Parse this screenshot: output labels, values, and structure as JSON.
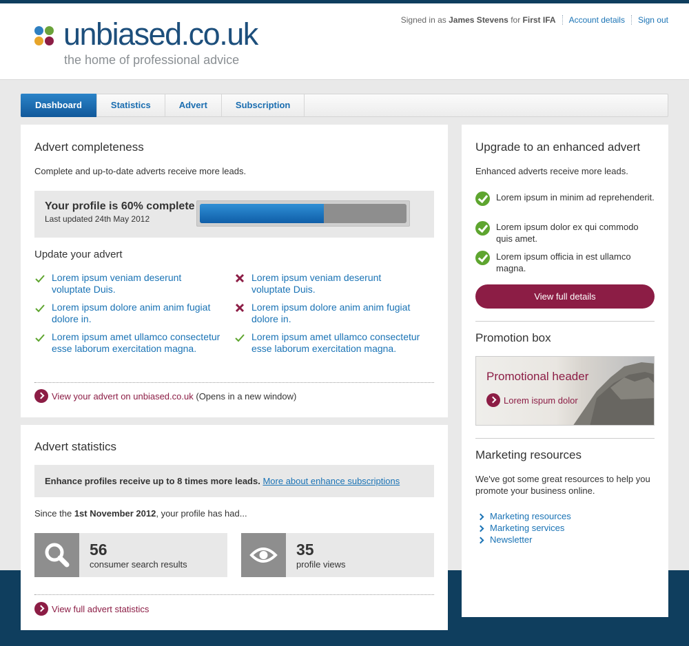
{
  "brand": {
    "logo_text": "unbiased.co.uk",
    "tagline": "the home of professional advice",
    "dot_colors": [
      "#2e7fc1",
      "#6aa33a",
      "#e7a52a",
      "#8c1d45"
    ]
  },
  "userbar": {
    "signed_in_prefix": "Signed in as",
    "user_name": "James Stevens",
    "for_text": "for",
    "firm": "First IFA",
    "account_link": "Account details",
    "signout_link": "Sign out"
  },
  "tabs": [
    {
      "label": "Dashboard",
      "active": true
    },
    {
      "label": "Statistics",
      "active": false
    },
    {
      "label": "Advert",
      "active": false
    },
    {
      "label": "Subscription",
      "active": false
    }
  ],
  "completeness": {
    "title": "Advert completeness",
    "intro": "Complete and up-to-date adverts receive more leads.",
    "progress_title": "Your profile is 60% complete",
    "last_updated": "Last updated 24th May 2012",
    "progress_fraction": 0.6,
    "update_heading": "Update your advert",
    "items": [
      {
        "text": "Lorem ipsum veniam deserunt voluptate Duis.",
        "status": "done"
      },
      {
        "text": "Lorem ipsum veniam deserunt voluptate Duis.",
        "status": "missing"
      },
      {
        "text": "Lorem ipsum dolore anim anim fugiat dolore in.",
        "status": "done"
      },
      {
        "text": "Lorem ipsum dolore anim anim fugiat dolore in.",
        "status": "missing"
      },
      {
        "text": "Lorem ipsum amet ullamco consectetur esse laborum exercitation magna.",
        "status": "done"
      },
      {
        "text": "Lorem ipsum amet ullamco consectetur esse laborum exercitation magna.",
        "status": "done"
      }
    ],
    "view_link": "View your advert on unbiased.co.uk",
    "view_note": "(Opens in a new window)"
  },
  "stats": {
    "title": "Advert statistics",
    "enhance_bold": "Enhance profiles receive up to 8 times more leads.",
    "enhance_link": "More about enhance subscriptions",
    "since_prefix": "Since the",
    "since_date": "1st November 2012",
    "since_suffix": ", your profile has had...",
    "search_count": "56",
    "search_label": "consumer search results",
    "views_count": "35",
    "views_label": "profile views",
    "full_link": "View full advert statistics"
  },
  "sidebar": {
    "upgrade_title": "Upgrade to an enhanced advert",
    "upgrade_intro": "Enhanced adverts receive more leads.",
    "features": [
      "Lorem ipsum in minim ad reprehenderit.",
      "Lorem ipsum dolor ex qui commodo quis amet.",
      "Lorem ipsum officia in est ullamco magna."
    ],
    "details_button": "View full details",
    "promo_title": "Promotion box",
    "promo_header": "Promotional header",
    "promo_link": "Lorem ispum dolor",
    "resources_title": "Marketing resources",
    "resources_intro": "We've got some great resources to help you promote your business online.",
    "resources": [
      "Marketing resources",
      "Marketing services",
      "Newsletter"
    ]
  },
  "colors": {
    "brand_blue": "#1d4f7c",
    "link_blue": "#1a73b5",
    "plum": "#8c1d45",
    "check_green": "#5ea52f",
    "navy_band": "#0f3e5e"
  }
}
